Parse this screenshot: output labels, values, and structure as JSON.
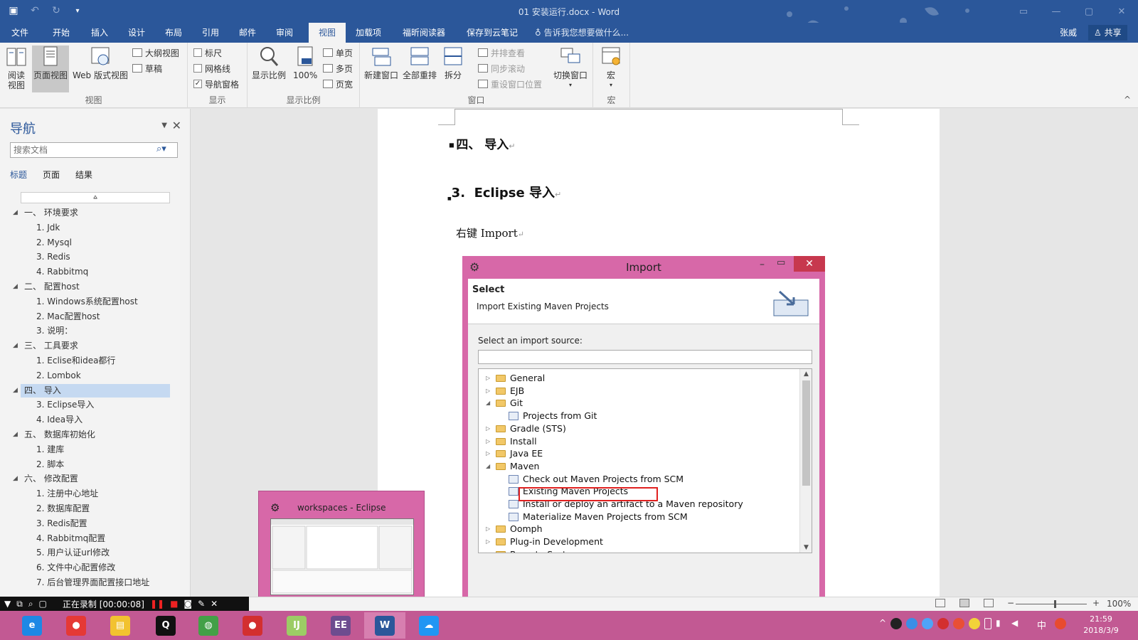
{
  "window": {
    "title": "01 安装运行.docx - Word",
    "qat": {
      "save_icon": "save-icon",
      "undo_icon": "undo-icon",
      "redo_icon": "redo-icon",
      "customize_icon": "customize-icon"
    }
  },
  "tabs": [
    "文件",
    "开始",
    "插入",
    "设计",
    "布局",
    "引用",
    "邮件",
    "审阅",
    "视图",
    "加载项",
    "福昕阅读器",
    "保存到云笔记"
  ],
  "active_tab": "视图",
  "tell_me": "告诉我您想要做什么...",
  "user": "张威",
  "share": "共享",
  "ribbon": {
    "views": {
      "reading": "阅读\n视图",
      "print": "页面视图",
      "web": "Web 版式视图",
      "outline": "大纲视图",
      "draft": "草稿",
      "label": "视图"
    },
    "show": {
      "ruler": "标尺",
      "gridlines": "网格线",
      "navpane": "导航窗格",
      "label": "显示"
    },
    "zoom": {
      "zoom": "显示比例",
      "hundred": "100%",
      "one_page": "单页",
      "multi_page": "多页",
      "page_width": "页宽",
      "label": "显示比例"
    },
    "window": {
      "new_window": "新建窗口",
      "arrange_all": "全部重排",
      "split": "拆分",
      "side_by_side": "并排查看",
      "sync_scroll": "同步滚动",
      "reset_pos": "重设窗口位置",
      "switch": "切换窗口",
      "label": "窗口"
    },
    "macros": {
      "macros": "宏",
      "label": "宏"
    }
  },
  "nav": {
    "title": "导航",
    "search_placeholder": "搜索文档",
    "tabs": [
      "标题",
      "页面",
      "结果"
    ],
    "items": [
      {
        "level": 1,
        "text": "一、 环境要求"
      },
      {
        "level": 2,
        "text": "1. Jdk"
      },
      {
        "level": 2,
        "text": "2. Mysql"
      },
      {
        "level": 2,
        "text": "3. Redis"
      },
      {
        "level": 2,
        "text": "4. Rabbitmq"
      },
      {
        "level": 1,
        "text": "二、 配置host"
      },
      {
        "level": 2,
        "text": "1. Windows系统配置host"
      },
      {
        "level": 2,
        "text": "2. Mac配置host"
      },
      {
        "level": 2,
        "text": "3. 说明："
      },
      {
        "level": 1,
        "text": "三、 工具要求"
      },
      {
        "level": 2,
        "text": "1. Eclise和idea都行"
      },
      {
        "level": 2,
        "text": "2. Lombok"
      },
      {
        "level": 1,
        "text": "四、 导入",
        "selected": true
      },
      {
        "level": 2,
        "text": "3. Eclipse导入"
      },
      {
        "level": 2,
        "text": "4. Idea导入"
      },
      {
        "level": 1,
        "text": "五、 数据库初始化"
      },
      {
        "level": 2,
        "text": "1. 建库"
      },
      {
        "level": 2,
        "text": "2. 脚本"
      },
      {
        "level": 1,
        "text": "六、 修改配置"
      },
      {
        "level": 2,
        "text": "1. 注册中心地址"
      },
      {
        "level": 2,
        "text": "2. 数据库配置"
      },
      {
        "level": 2,
        "text": "3. Redis配置"
      },
      {
        "level": 2,
        "text": "4. Rabbitmq配置"
      },
      {
        "level": 2,
        "text": "5. 用户认证url修改"
      },
      {
        "level": 2,
        "text": "6. 文件中心配置修改"
      },
      {
        "level": 2,
        "text": "7. 后台管理界面配置接口地址"
      }
    ]
  },
  "doc": {
    "heading2": "四、   导入",
    "heading3_num": "3.",
    "heading3_text": "Eclipse 导入",
    "para": "右键 Import",
    "pilcrow": "↵"
  },
  "import_dialog": {
    "title": "Import",
    "select": "Select",
    "subtitle": "Import Existing Maven Projects",
    "source_label": "Select an import source:",
    "tree": [
      {
        "indent": 0,
        "arrow": "▷",
        "kind": "folder",
        "text": "General"
      },
      {
        "indent": 0,
        "arrow": "▷",
        "kind": "folder",
        "text": "EJB"
      },
      {
        "indent": 0,
        "arrow": "◢",
        "kind": "folder",
        "text": "Git"
      },
      {
        "indent": 1,
        "arrow": "",
        "kind": "item",
        "text": "Projects from Git"
      },
      {
        "indent": 0,
        "arrow": "▷",
        "kind": "folder",
        "text": "Gradle (STS)"
      },
      {
        "indent": 0,
        "arrow": "▷",
        "kind": "folder",
        "text": "Install"
      },
      {
        "indent": 0,
        "arrow": "▷",
        "kind": "folder",
        "text": "Java EE"
      },
      {
        "indent": 0,
        "arrow": "◢",
        "kind": "folder",
        "text": "Maven"
      },
      {
        "indent": 1,
        "arrow": "",
        "kind": "item",
        "text": "Check out Maven Projects from SCM"
      },
      {
        "indent": 1,
        "arrow": "",
        "kind": "item",
        "text": "Existing Maven Projects"
      },
      {
        "indent": 1,
        "arrow": "",
        "kind": "item",
        "text": "Install or deploy an artifact to a Maven repository"
      },
      {
        "indent": 1,
        "arrow": "",
        "kind": "item",
        "text": "Materialize Maven Projects from SCM"
      },
      {
        "indent": 0,
        "arrow": "▷",
        "kind": "folder",
        "text": "Oomph"
      },
      {
        "indent": 0,
        "arrow": "▷",
        "kind": "folder",
        "text": "Plug-in Development"
      },
      {
        "indent": 0,
        "arrow": "▷",
        "kind": "folder",
        "text": "Remote Systems"
      }
    ]
  },
  "taskbar_thumb": {
    "title": "workspaces - Eclipse"
  },
  "recorder": {
    "status": "正在录制 [00:00:08]"
  },
  "status": {
    "zoom": "100%",
    "minus": "−",
    "plus": "+"
  },
  "taskbar": {
    "apps": [
      {
        "name": "ie",
        "icon": "ie-icon",
        "glyph": "e",
        "color": "#1e88e5"
      },
      {
        "name": "chrome",
        "icon": "chrome-icon",
        "glyph": "●",
        "color": "#e53935"
      },
      {
        "name": "explorer",
        "icon": "folder-icon",
        "glyph": "▤",
        "color": "#f2c230"
      },
      {
        "name": "qq",
        "icon": "qq-penguin-icon",
        "glyph": "Q",
        "color": "#111111"
      },
      {
        "name": "wechat",
        "icon": "wechat-icon",
        "glyph": "◍",
        "color": "#43a047"
      },
      {
        "name": "recorder",
        "icon": "record-icon",
        "glyph": "●",
        "color": "#d32f2f"
      },
      {
        "name": "idea",
        "icon": "intellij-icon",
        "glyph": "IJ",
        "color": "#9ccc65"
      },
      {
        "name": "eclipse",
        "icon": "eclipse-icon",
        "glyph": "EE",
        "color": "#6d4c8f"
      },
      {
        "name": "word",
        "icon": "word-icon",
        "glyph": "W",
        "color": "#2b579a"
      },
      {
        "name": "baidu",
        "icon": "cloud-icon",
        "glyph": "☁",
        "color": "#2196f3"
      }
    ],
    "ime": "中",
    "time": "21:59",
    "date": "2018/3/9"
  }
}
